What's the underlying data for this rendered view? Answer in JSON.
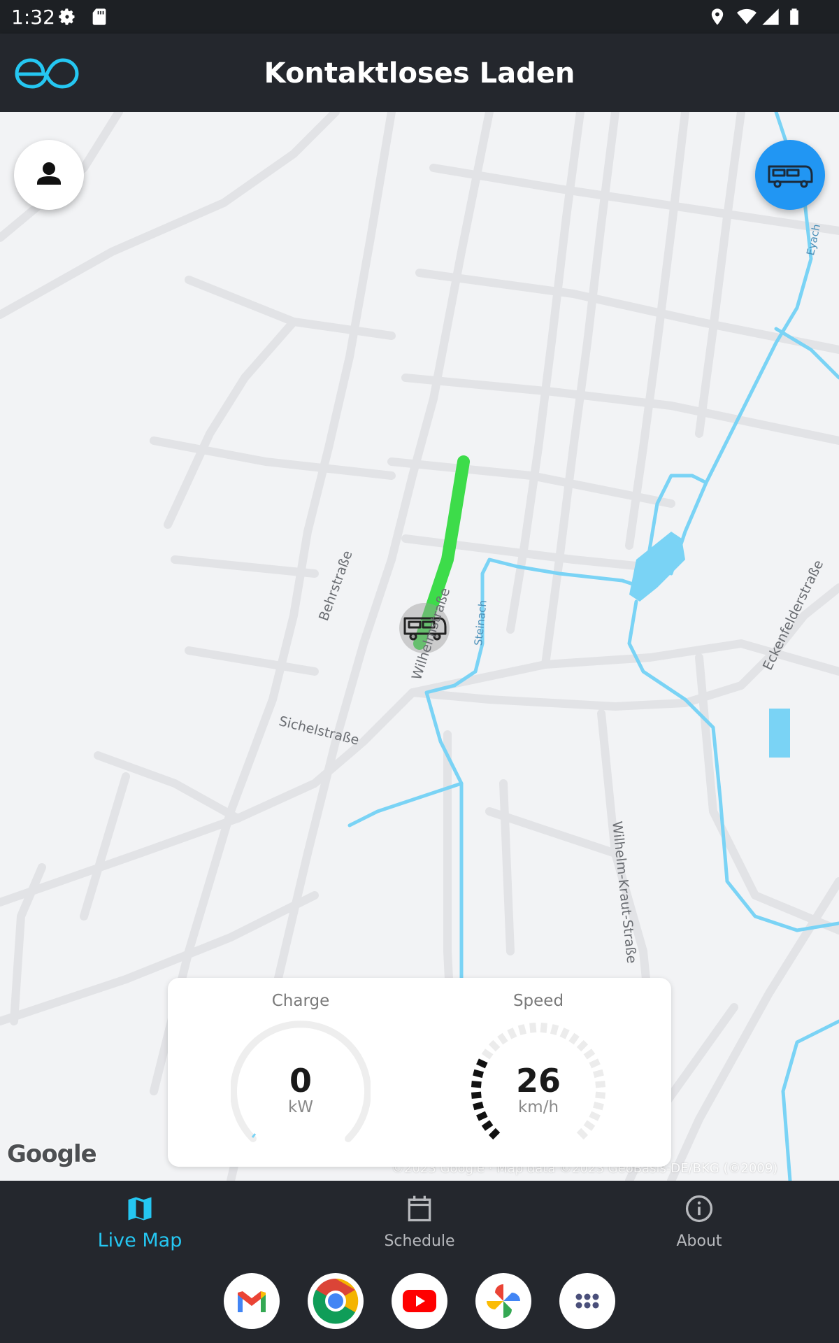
{
  "status_bar": {
    "time": "1:32",
    "icons": [
      "settings-icon",
      "sd-card-icon",
      "location-icon",
      "wifi-icon",
      "signal-icon",
      "battery-icon"
    ]
  },
  "app_bar": {
    "title": "Kontaktloses Laden",
    "logo": "eo-logo"
  },
  "map": {
    "streets": [
      "Behrstraße",
      "Sichelstraße",
      "Wilhelmstraße",
      "Wilhelm-Kraut-Straße",
      "Eckenfelderstraße"
    ],
    "waterways": [
      "Steinach",
      "Eyach"
    ],
    "attribution": "©2023 Google · Map data ©2023 GeoBasis-DE/BKG (©2009)",
    "google_logo": "Google",
    "route_color": "#3ddc4a",
    "water_color": "#7ad3f5"
  },
  "buttons": {
    "profile": "person-icon",
    "vehicle": "bus-icon"
  },
  "gauges": {
    "charge": {
      "label": "Charge",
      "value": "0",
      "unit": "kW",
      "fraction": 0
    },
    "speed": {
      "label": "Speed",
      "value": "26",
      "unit": "km/h",
      "fraction": 0.26
    }
  },
  "nav": {
    "items": [
      {
        "label": "Live Map",
        "icon": "map-icon",
        "active": true
      },
      {
        "label": "Schedule",
        "icon": "calendar-icon",
        "active": false
      },
      {
        "label": "About",
        "icon": "info-icon",
        "active": false
      }
    ]
  },
  "dock": {
    "apps": [
      "gmail-icon",
      "chrome-icon",
      "youtube-icon",
      "photos-icon",
      "app-drawer-icon"
    ]
  },
  "colors": {
    "accent": "#25c7f2",
    "fab_blue": "#2196f3",
    "bar_dark": "#24272d"
  }
}
